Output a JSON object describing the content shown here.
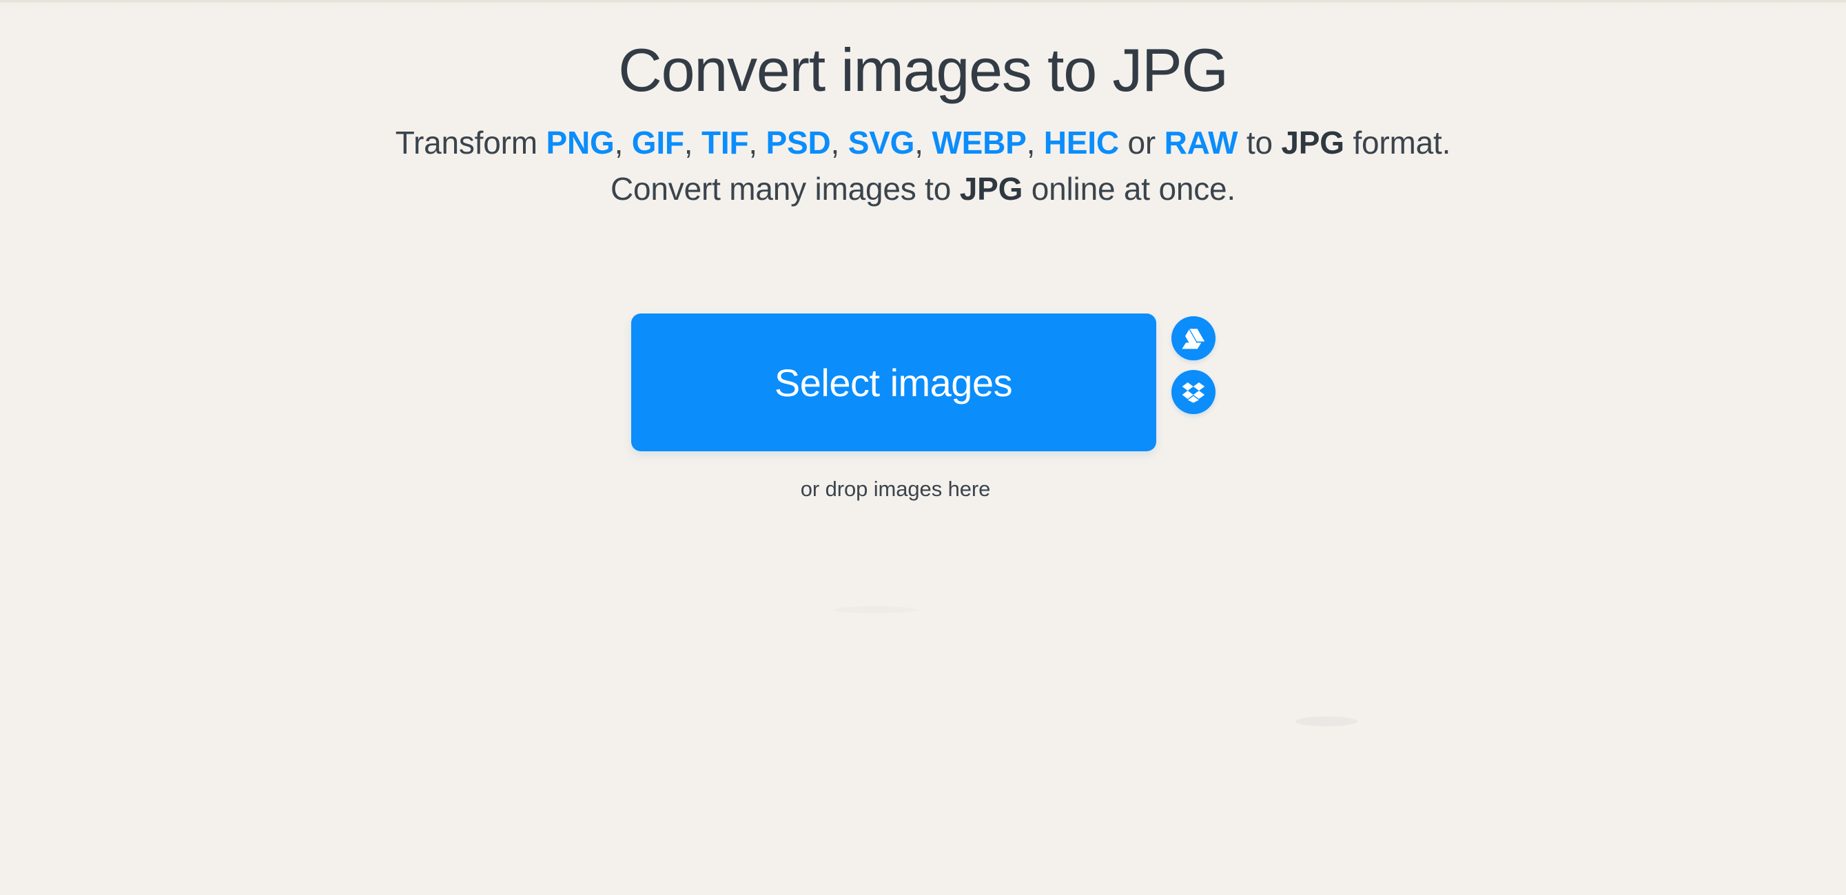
{
  "theme": {
    "background": "#f4f1ec",
    "accent": "#0b8dfb",
    "heading_color": "#333c45",
    "body_color": "#3b444d",
    "button_text_color": "#ffffff"
  },
  "hero": {
    "title": "Convert images to JPG",
    "subtitle_line1": {
      "lead": "Transform ",
      "formats": [
        "PNG",
        "GIF",
        "TIF",
        "PSD",
        "SVG",
        "WEBP",
        "HEIC"
      ],
      "separator": ", ",
      "conjunction": " or ",
      "last_format": "RAW",
      "middle": " to ",
      "target_format": "JPG",
      "tail": " format."
    },
    "subtitle_line1_plain": "Transform PNG, GIF, TIF, PSD, SVG, WEBP, HEIC or RAW to JPG format.",
    "subtitle_line2": {
      "lead": "Convert many images to ",
      "target_format": "JPG",
      "tail": " online at once."
    },
    "subtitle_line2_plain": "Convert many images to JPG online at once."
  },
  "uploader": {
    "select_button_label": "Select images",
    "drop_hint": "or drop images here",
    "cloud_buttons": [
      {
        "name": "google-drive",
        "icon": "google-drive-icon",
        "label": "Google Drive"
      },
      {
        "name": "dropbox",
        "icon": "dropbox-icon",
        "label": "Dropbox"
      }
    ]
  }
}
